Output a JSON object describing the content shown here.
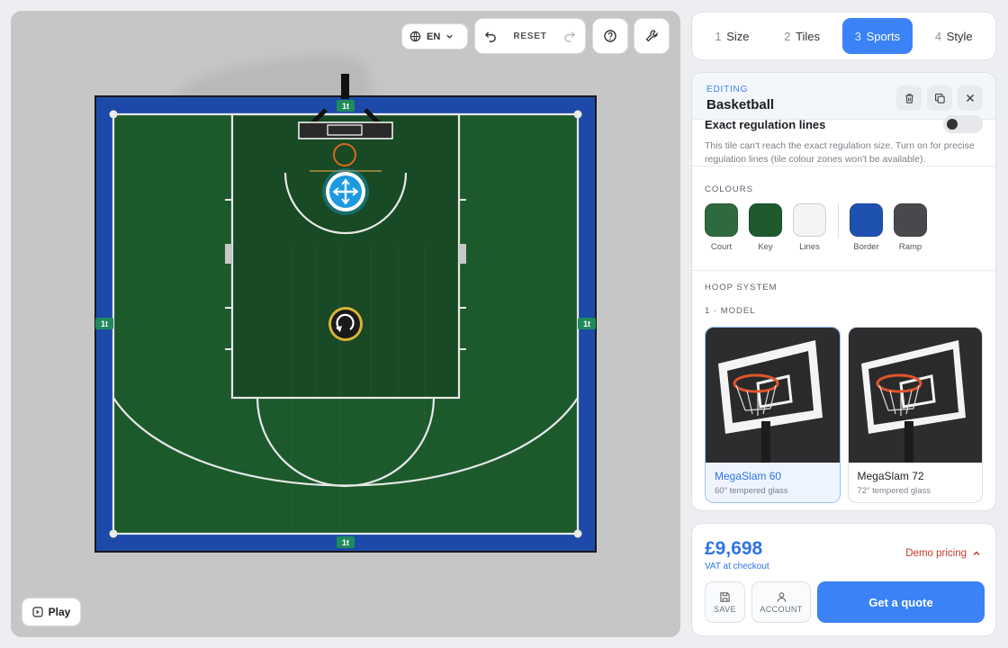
{
  "viewport": {
    "language": "EN",
    "reset_label": "RESET",
    "play_label": "Play",
    "tile_marker": "1t"
  },
  "steps": [
    {
      "num": "1",
      "label": "Size"
    },
    {
      "num": "2",
      "label": "Tiles"
    },
    {
      "num": "3",
      "label": "Sports",
      "active": true
    },
    {
      "num": "4",
      "label": "Style"
    }
  ],
  "editor": {
    "tag": "EDITING",
    "title": "Basketball",
    "regulation": {
      "title": "Exact regulation lines",
      "enabled": false,
      "note": "This tile can't reach the exact regulation size. Turn on for precise regulation lines (tile colour zones won't be available)."
    },
    "colours": {
      "label": "COLOURS",
      "swatches": [
        {
          "label": "Court",
          "color": "#2e6a3e"
        },
        {
          "label": "Key",
          "color": "#1f5a2f"
        },
        {
          "label": "Lines",
          "color": "#f4f4f6"
        },
        {
          "label": "Border",
          "color": "#1f52b0"
        },
        {
          "label": "Ramp",
          "color": "#48494c"
        }
      ]
    },
    "hoop": {
      "label": "HOOP SYSTEM",
      "model_label": "1 · MODEL",
      "models": [
        {
          "name": "MegaSlam 60",
          "sub": "60\" tempered glass",
          "selected": true
        },
        {
          "name": "MegaSlam 72",
          "sub": "72\" tempered glass",
          "selected": false
        }
      ]
    }
  },
  "pricing": {
    "price": "£9,698",
    "vat": "VAT at checkout",
    "demo": "Demo pricing",
    "save": "SAVE",
    "account": "ACCOUNT",
    "quote": "Get a quote"
  },
  "colors": {
    "accent": "#3b82f6",
    "court": "#1c5a2c",
    "key": "#174a25",
    "border": "#1d4aa8"
  }
}
